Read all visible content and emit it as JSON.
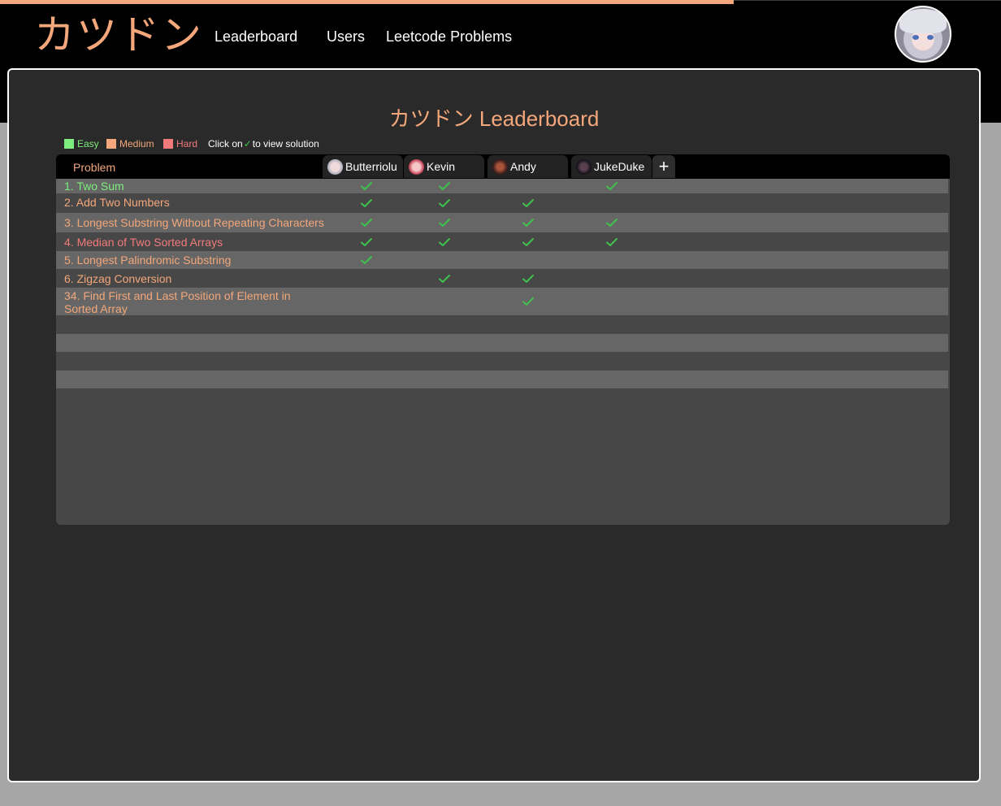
{
  "app": {
    "logo": "カツドン"
  },
  "nav": {
    "links": [
      "Leaderboard",
      "Users",
      "Leetcode Problems"
    ]
  },
  "page": {
    "title": "カツドン Leaderboard",
    "legend": {
      "easy": "Easy",
      "medium": "Medium",
      "hard": "Hard",
      "hint_prefix": "Click on",
      "hint_suffix": "to view solution"
    }
  },
  "colors": {
    "accent": "#f3a77a",
    "easy": "#7dee7d",
    "medium": "#f3a77a",
    "hard": "#f37a7a",
    "check": "#3fc14c"
  },
  "table": {
    "problem_header": "Problem",
    "users": [
      "Butterriolu",
      "Kevin",
      "Andy",
      "JukeDuke"
    ],
    "add_user_label": "+",
    "rows": [
      {
        "title": "1. Two Sum",
        "difficulty": "easy",
        "solved": [
          true,
          true,
          false,
          true
        ]
      },
      {
        "title": "2. Add Two Numbers",
        "difficulty": "medium",
        "solved": [
          true,
          true,
          true,
          false
        ]
      },
      {
        "title": "3. Longest Substring Without Repeating Characters",
        "difficulty": "medium",
        "solved": [
          true,
          true,
          true,
          true
        ]
      },
      {
        "title": "4. Median of Two Sorted Arrays",
        "difficulty": "hard",
        "solved": [
          true,
          true,
          true,
          true
        ]
      },
      {
        "title": "5. Longest Palindromic Substring",
        "difficulty": "medium",
        "solved": [
          true,
          false,
          false,
          false
        ]
      },
      {
        "title": "6. Zigzag Conversion",
        "difficulty": "medium",
        "solved": [
          false,
          true,
          true,
          false
        ]
      },
      {
        "title": "34. Find First and Last Position of Element in Sorted Array",
        "difficulty": "medium",
        "solved": [
          false,
          false,
          true,
          false
        ]
      }
    ]
  }
}
